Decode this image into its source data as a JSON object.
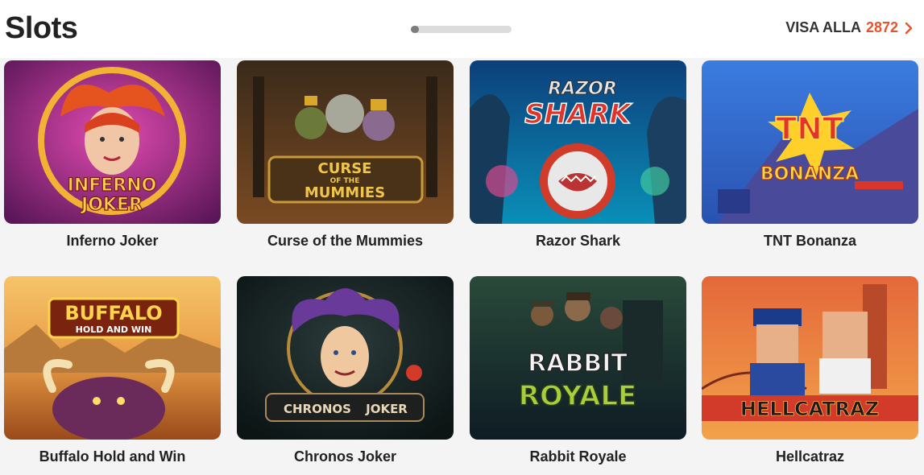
{
  "header": {
    "title": "Slots",
    "see_all_label": "VISA ALLA",
    "see_all_count": "2872"
  },
  "games": [
    {
      "name": "Inferno Joker",
      "art_lines": [
        "INFERNO",
        "JOKER"
      ]
    },
    {
      "name": "Curse of the Mummies",
      "art_lines": [
        "CURSE",
        "OF THE",
        "MUMMIES"
      ]
    },
    {
      "name": "Razor Shark",
      "art_lines": [
        "RAZOR",
        "SHARK"
      ]
    },
    {
      "name": "TNT Bonanza",
      "art_lines": [
        "TNT",
        "BONANZA"
      ]
    },
    {
      "name": "Buffalo Hold and Win",
      "art_lines": [
        "BUFFALO",
        "HOLD AND WIN"
      ]
    },
    {
      "name": "Chronos Joker",
      "art_lines": [
        "CHRONOS",
        "JOKER"
      ]
    },
    {
      "name": "Rabbit Royale",
      "art_lines": [
        "RABBIT",
        "ROYALE"
      ]
    },
    {
      "name": "Hellcatraz",
      "art_lines": [
        "HELLCATRAZ"
      ]
    }
  ],
  "colors": {
    "accent": "#e8542a",
    "text": "#222222",
    "background": "#f4f4f4"
  }
}
